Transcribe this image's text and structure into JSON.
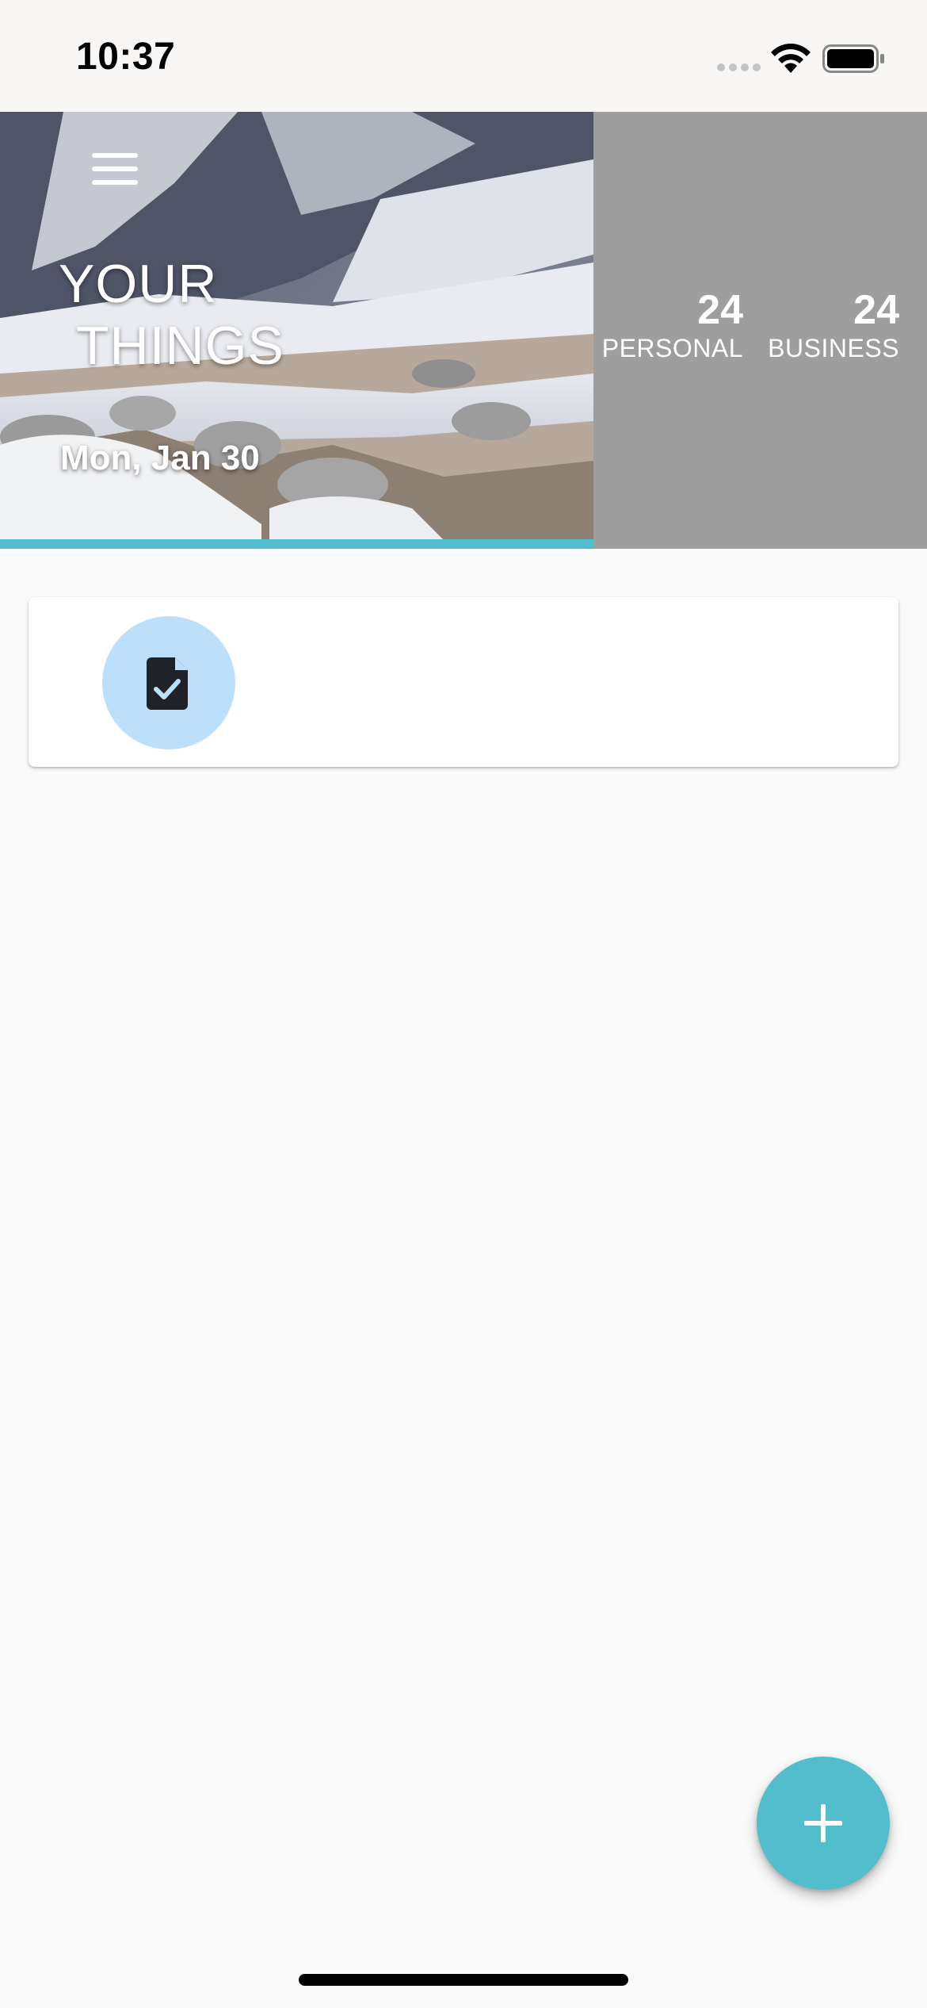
{
  "status_bar": {
    "time": "10:37",
    "icons": [
      "cellular-signal-icon",
      "wifi-icon",
      "battery-icon"
    ]
  },
  "header": {
    "title_line1": "YOUR",
    "title_line2": "THINGS",
    "date": "Mon, Jan 30",
    "menu_icon": "hamburger-menu-icon",
    "accent_color": "#52bdcd",
    "stats": [
      {
        "count": "24",
        "label": "PERSONAL"
      },
      {
        "count": "24",
        "label": "BUSINESS"
      }
    ]
  },
  "tasks": [
    {
      "icon": "task-document-check-icon",
      "icon_bg": "#bcdffb"
    }
  ],
  "fab": {
    "icon": "plus-icon",
    "color": "#52bdcd"
  }
}
